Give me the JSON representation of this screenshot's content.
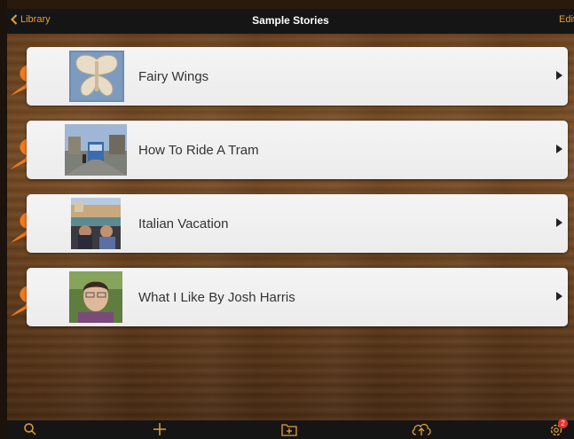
{
  "header": {
    "back_label": "Library",
    "title": "Sample Stories",
    "edit_label": "Edit"
  },
  "stories": [
    {
      "title": "Fairy Wings",
      "thumbnail": "butterfly-cutout-photo"
    },
    {
      "title": "How To Ride A Tram",
      "thumbnail": "tram-street-photo"
    },
    {
      "title": "Italian Vacation",
      "thumbnail": "venice-gondola-photo"
    },
    {
      "title": "What I Like By Josh Harris",
      "thumbnail": "boy-portrait-photo"
    }
  ],
  "toolbar": {
    "icons": [
      "search-icon",
      "add-icon",
      "add-folder-icon",
      "cloud-upload-icon",
      "settings-icon"
    ],
    "settings_badge": "2"
  },
  "colors": {
    "accent": "#e8a030",
    "bar": "#151515",
    "tag": "#f07a1e",
    "badge": "#e5322c"
  }
}
